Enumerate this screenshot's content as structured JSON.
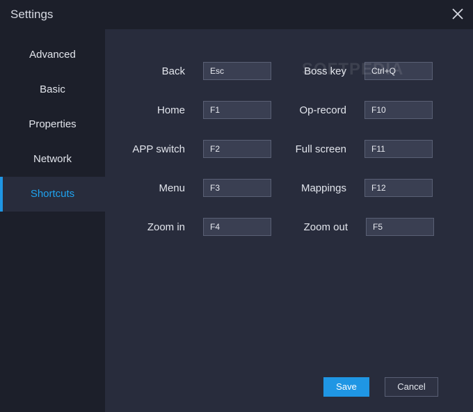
{
  "window": {
    "title": "Settings"
  },
  "sidebar": {
    "items": [
      {
        "label": "Advanced"
      },
      {
        "label": "Basic"
      },
      {
        "label": "Properties"
      },
      {
        "label": "Network"
      },
      {
        "label": "Shortcuts",
        "active": true
      }
    ]
  },
  "shortcuts": {
    "left": [
      {
        "label": "Back",
        "value": "Esc"
      },
      {
        "label": "Home",
        "value": "F1"
      },
      {
        "label": "APP switch",
        "value": "F2"
      },
      {
        "label": "Menu",
        "value": "F3"
      },
      {
        "label": "Zoom in",
        "value": "F4"
      }
    ],
    "right": [
      {
        "label": "Boss key",
        "value": "Ctrl+Q"
      },
      {
        "label": "Op-record",
        "value": "F10"
      },
      {
        "label": "Full screen",
        "value": "F11"
      },
      {
        "label": "Mappings",
        "value": "F12"
      },
      {
        "label": "Zoom out",
        "value": "F5"
      }
    ]
  },
  "watermark": "SOFTPEDIA",
  "buttons": {
    "save": "Save",
    "cancel": "Cancel"
  },
  "colors": {
    "accent": "#1f96e4",
    "background": "#1c1f2a",
    "panel": "#282c3c"
  },
  "icons": {
    "close": "close-icon"
  }
}
